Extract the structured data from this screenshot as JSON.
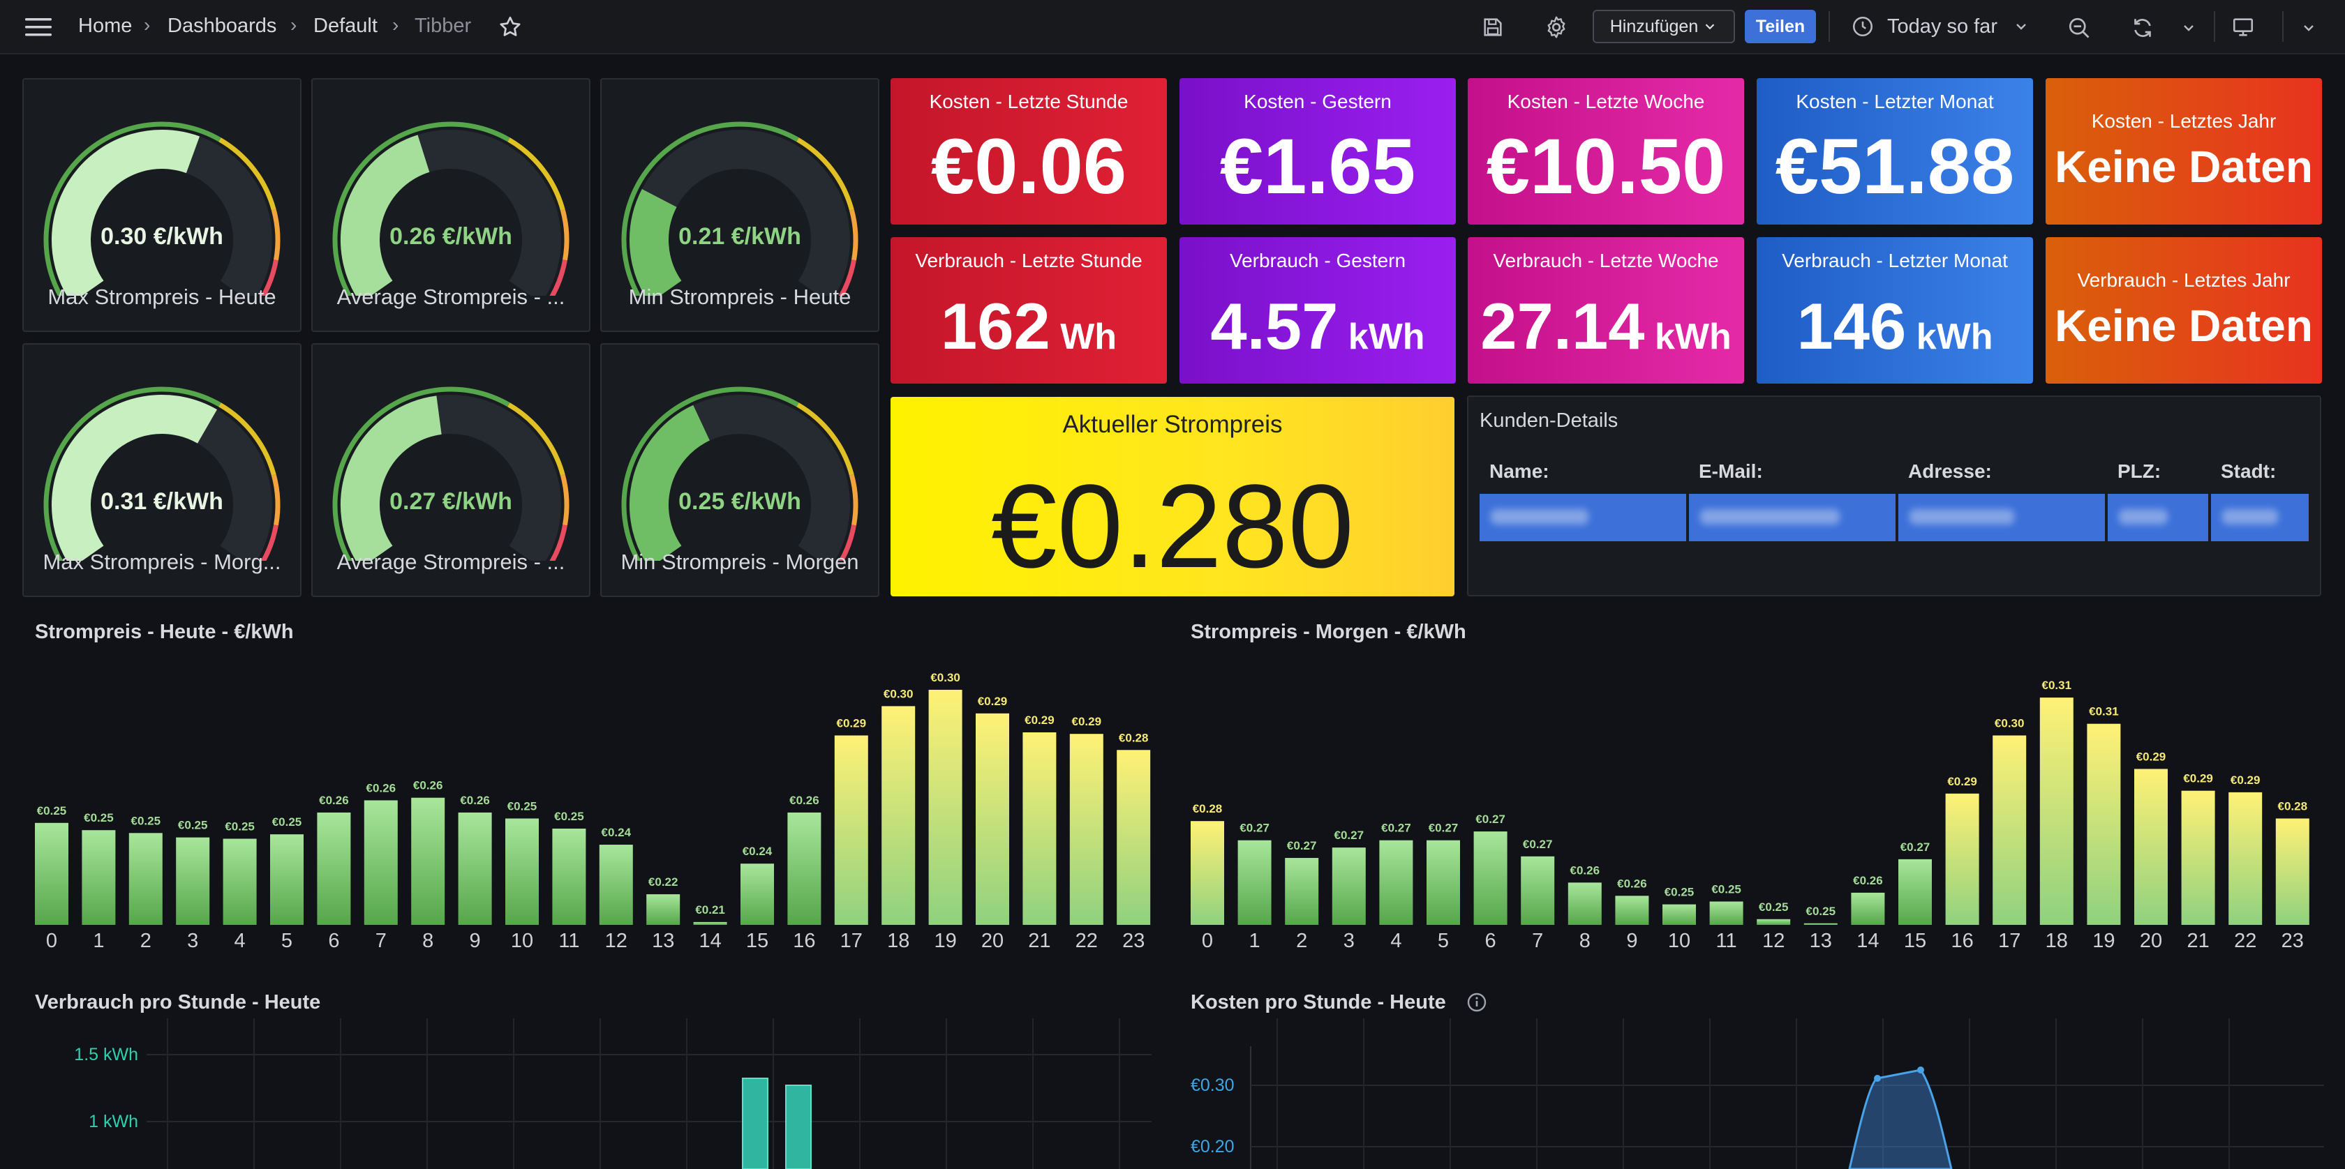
{
  "breadcrumb": {
    "home": "Home",
    "dashboards": "Dashboards",
    "folder": "Default",
    "current": "Tibber"
  },
  "toolbar": {
    "add_label": "Hinzufügen",
    "share_label": "Teilen",
    "time_range": "Today so far"
  },
  "icons": [
    "menu-icon",
    "star-icon",
    "save-icon",
    "gear-icon",
    "chevron-down-icon",
    "clock-icon",
    "zoom-out-icon",
    "refresh-icon",
    "monitor-icon"
  ],
  "colors": {
    "green": "#73bf69",
    "red": "#d01d2f",
    "purple": "#8a14d6",
    "magenta": "#d41d9a",
    "blue": "#2a6fd6",
    "orange": "#e0501a",
    "yellow": "#fff200",
    "teal": "#2fb5a0",
    "table_row": "#3d71d9"
  },
  "gauges": [
    {
      "title": "Max Strompreis - Heute",
      "value": "0.30 €/kWh",
      "fraction": 0.58
    },
    {
      "title": "Average Strompreis - ...",
      "value": "0.26 €/kWh",
      "fraction": 0.43
    },
    {
      "title": "Min Strompreis - Heute",
      "value": "0.21 €/kWh",
      "fraction": 0.25
    },
    {
      "title": "Max Strompreis - Morg...",
      "value": "0.31 €/kWh",
      "fraction": 0.62
    },
    {
      "title": "Average Strompreis - ...",
      "value": "0.27 €/kWh",
      "fraction": 0.47
    },
    {
      "title": "Min Strompreis - Morgen",
      "value": "0.25 €/kWh",
      "fraction": 0.4
    }
  ],
  "stats": [
    {
      "title": "Kosten - Letzte Stunde",
      "value": "€0.06",
      "unit": ""
    },
    {
      "title": "Kosten - Gestern",
      "value": "€1.65",
      "unit": ""
    },
    {
      "title": "Kosten - Letzte Woche",
      "value": "€10.50",
      "unit": ""
    },
    {
      "title": "Kosten - Letzter Monat",
      "value": "€51.88",
      "unit": ""
    },
    {
      "title": "Kosten - Letztes Jahr",
      "value": "Keine Daten",
      "unit": ""
    },
    {
      "title": "Verbrauch - Letzte Stunde",
      "value": "162",
      "unit": "Wh"
    },
    {
      "title": "Verbrauch - Gestern",
      "value": "4.57",
      "unit": "kWh"
    },
    {
      "title": "Verbrauch - Letzte Woche",
      "value": "27.14",
      "unit": "kWh"
    },
    {
      "title": "Verbrauch - Letzter Monat",
      "value": "146",
      "unit": "kWh"
    },
    {
      "title": "Verbrauch - Letztes Jahr",
      "value": "Keine Daten",
      "unit": ""
    }
  ],
  "current_price": {
    "title": "Aktueller Strompreis",
    "value": "€0.280"
  },
  "kunden": {
    "title": "Kunden-Details",
    "columns": [
      "Name:",
      "E-Mail:",
      "Adresse:",
      "PLZ:",
      "Stadt:"
    ]
  },
  "chart_data": [
    {
      "type": "bar",
      "title": "Strompreis - Heute - €/kWh",
      "categories": [
        "0",
        "1",
        "2",
        "3",
        "4",
        "5",
        "6",
        "7",
        "8",
        "9",
        "10",
        "11",
        "12",
        "13",
        "14",
        "15",
        "16",
        "17",
        "18",
        "19",
        "20",
        "21",
        "22",
        "23"
      ],
      "values": [
        0.25,
        0.25,
        0.25,
        0.25,
        0.25,
        0.25,
        0.26,
        0.26,
        0.26,
        0.26,
        0.25,
        0.25,
        0.24,
        0.22,
        0.21,
        0.24,
        0.26,
        0.29,
        0.3,
        0.3,
        0.29,
        0.29,
        0.29,
        0.28
      ],
      "labels": [
        "€0.25",
        "€0.25",
        "€0.25",
        "€0.25",
        "€0.25",
        "€0.25",
        "€0.26",
        "€0.26",
        "€0.26",
        "€0.26",
        "€0.25",
        "€0.25",
        "€0.24",
        "€0.22",
        "€0.21",
        "€0.24",
        "€0.26",
        "€0.29",
        "€0.30",
        "€0.30",
        "€0.29",
        "€0.29",
        "€0.29",
        "€0.28"
      ],
      "bar_heights_relative": [
        0.393,
        0.365,
        0.354,
        0.337,
        0.332,
        0.349,
        0.433,
        0.48,
        0.49,
        0.433,
        0.41,
        0.371,
        0.309,
        0.118,
        0.011,
        0.236,
        0.433,
        0.73,
        0.843,
        0.906,
        0.815,
        0.742,
        0.736,
        0.674
      ],
      "grid": false
    },
    {
      "type": "bar",
      "title": "Strompreis - Morgen - €/kWh",
      "categories": [
        "0",
        "1",
        "2",
        "3",
        "4",
        "5",
        "6",
        "7",
        "8",
        "9",
        "10",
        "11",
        "12",
        "13",
        "14",
        "15",
        "16",
        "17",
        "18",
        "19",
        "20",
        "21",
        "22",
        "23"
      ],
      "values": [
        0.28,
        0.27,
        0.27,
        0.27,
        0.27,
        0.27,
        0.27,
        0.27,
        0.26,
        0.26,
        0.25,
        0.25,
        0.25,
        0.25,
        0.26,
        0.27,
        0.29,
        0.3,
        0.31,
        0.31,
        0.29,
        0.29,
        0.29,
        0.28
      ],
      "labels": [
        "€0.28",
        "€0.27",
        "€0.27",
        "€0.27",
        "€0.27",
        "€0.27",
        "€0.27",
        "€0.27",
        "€0.26",
        "€0.26",
        "€0.25",
        "€0.25",
        "€0.25",
        "€0.25",
        "€0.26",
        "€0.27",
        "€0.29",
        "€0.30",
        "€0.31",
        "€0.31",
        "€0.29",
        "€0.29",
        "€0.29",
        "€0.28"
      ],
      "bar_heights_relative": [
        0.4,
        0.326,
        0.258,
        0.298,
        0.326,
        0.326,
        0.36,
        0.264,
        0.163,
        0.112,
        0.079,
        0.09,
        0.022,
        0.006,
        0.124,
        0.253,
        0.506,
        0.73,
        0.876,
        0.775,
        0.601,
        0.517,
        0.511,
        0.41
      ],
      "grid": false
    },
    {
      "type": "bar",
      "title": "Verbrauch pro Stunde - Heute",
      "ytick_labels": [
        "1.5 kWh",
        "1 kWh"
      ],
      "ytick_values": [
        1.5,
        1.0
      ],
      "grid": true
    },
    {
      "type": "area",
      "title": "Kosten pro Stunde - Heute",
      "ytick_labels": [
        "€0.30",
        "€0.20"
      ],
      "ytick_values": [
        0.3,
        0.2
      ],
      "grid": true
    }
  ]
}
